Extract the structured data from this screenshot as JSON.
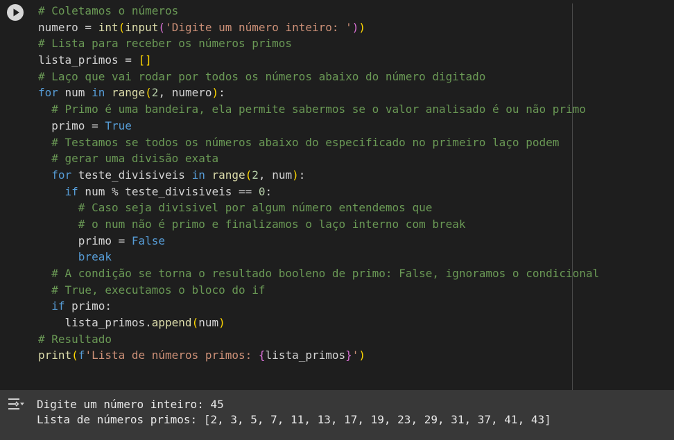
{
  "cell": {
    "run_button_icon": "play-icon",
    "code_lines": [
      "# Coletamos o números",
      "numero = int(input('Digite um número inteiro: '))",
      "# Lista para receber os números primos",
      "lista_primos = []",
      "# Laço que vai rodar por todos os números abaixo do número digitado",
      "for num in range(2, numero):",
      "  # Primo é uma bandeira, ela permite sabermos se o valor analisado é ou não primo",
      "  primo = True",
      "  # Testamos se todos os números abaixo do especificado no primeiro laço podem",
      "  # gerar uma divisão exata",
      "  for teste_divisiveis in range(2, num):",
      "    if num % teste_divisiveis == 0:",
      "      # Caso seja divisivel por algum número entendemos que",
      "      # o num não é primo e finalizamos o laço interno com break",
      "      primo = False",
      "      break",
      "  # A condição se torna o resultado booleno de primo: False, ignoramos o condicional",
      "  # True, executamos o bloco do if",
      "  if primo:",
      "    lista_primos.append(num)",
      "# Resultado",
      "print(f'Lista de números primos: {lista_primos}')"
    ]
  },
  "output": {
    "icon": "output-toggle-icon",
    "lines": [
      "Digite um número inteiro: 45",
      "Lista de números primos: [2, 3, 5, 7, 11, 13, 17, 19, 23, 29, 31, 37, 41, 43]"
    ]
  },
  "colors": {
    "background": "#1e1e1e",
    "output_background": "#383838",
    "comment": "#6a9955",
    "keyword": "#569cd6",
    "string": "#ce9178",
    "number": "#b5cea8",
    "builtin": "#dcdcaa"
  }
}
